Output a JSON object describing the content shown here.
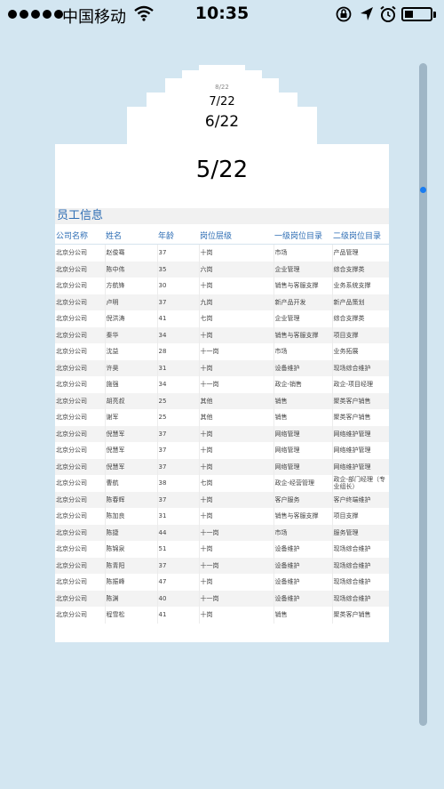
{
  "status_bar": {
    "carrier": "中国移动",
    "time": "10:35"
  },
  "page_stack": {
    "labels": [
      "6/22",
      "7/22",
      "8/22"
    ],
    "current": "5/22"
  },
  "sheet": {
    "title": "员工信息",
    "columns": [
      "公司名称",
      "姓名",
      "年龄",
      "岗位层级",
      "一级岗位目录",
      "二级岗位目录"
    ],
    "rows": [
      [
        "北京分公司",
        "赵俊骞",
        "37",
        "十岗",
        "市场",
        "产品管理"
      ],
      [
        "北京分公司",
        "陈中伟",
        "35",
        "六岗",
        "企业管理",
        "综合支撑类"
      ],
      [
        "北京分公司",
        "方航锋",
        "30",
        "十岗",
        "销售与客服支撑",
        "业务系统支撑"
      ],
      [
        "北京分公司",
        "卢明",
        "37",
        "九岗",
        "新产品开发",
        "新产品策划"
      ],
      [
        "北京分公司",
        "倪洪涛",
        "41",
        "七岗",
        "企业管理",
        "综合支撑类"
      ],
      [
        "北京分公司",
        "秦华",
        "34",
        "十岗",
        "销售与客服支撑",
        "项目支撑"
      ],
      [
        "北京分公司",
        "沈益",
        "28",
        "十一岗",
        "市场",
        "业务拓展"
      ],
      [
        "北京分公司",
        "许昊",
        "31",
        "十岗",
        "设备维护",
        "现场综合维护"
      ],
      [
        "北京分公司",
        "施强",
        "34",
        "十一岗",
        "政企-销售",
        "政企-项目经理"
      ],
      [
        "北京分公司",
        "胡亮叔",
        "25",
        "其他",
        "销售",
        "聚类客户销售"
      ],
      [
        "北京分公司",
        "谢军",
        "25",
        "其他",
        "销售",
        "聚类客户销售"
      ],
      [
        "北京分公司",
        "倪慧军",
        "37",
        "十岗",
        "网络管理",
        "网络维护管理"
      ],
      [
        "北京分公司",
        "倪慧军",
        "37",
        "十岗",
        "网络管理",
        "网络维护管理"
      ],
      [
        "北京分公司",
        "倪慧军",
        "37",
        "十岗",
        "网络管理",
        "网络维护管理"
      ],
      [
        "北京分公司",
        "曹航",
        "38",
        "七岗",
        "政企-经营管理",
        "政企-部门经理（专业组长）"
      ],
      [
        "北京分公司",
        "陈春辉",
        "37",
        "十岗",
        "客户服务",
        "客户终端维护"
      ],
      [
        "北京分公司",
        "陈加良",
        "31",
        "十岗",
        "销售与客服支撑",
        "项目支撑"
      ],
      [
        "北京分公司",
        "陈捷",
        "44",
        "十一岗",
        "市场",
        "服务管理"
      ],
      [
        "北京分公司",
        "陈锦泉",
        "51",
        "十岗",
        "设备维护",
        "现场综合维护"
      ],
      [
        "北京分公司",
        "陈青阳",
        "37",
        "十一岗",
        "设备维护",
        "现场综合维护"
      ],
      [
        "北京分公司",
        "陈振峰",
        "47",
        "十岗",
        "设备维护",
        "现场综合维护"
      ],
      [
        "北京分公司",
        "陈渊",
        "40",
        "十一岗",
        "设备维护",
        "现场综合维护"
      ],
      [
        "北京分公司",
        "程雪松",
        "41",
        "十岗",
        "销售",
        "聚类客户销售"
      ]
    ]
  }
}
